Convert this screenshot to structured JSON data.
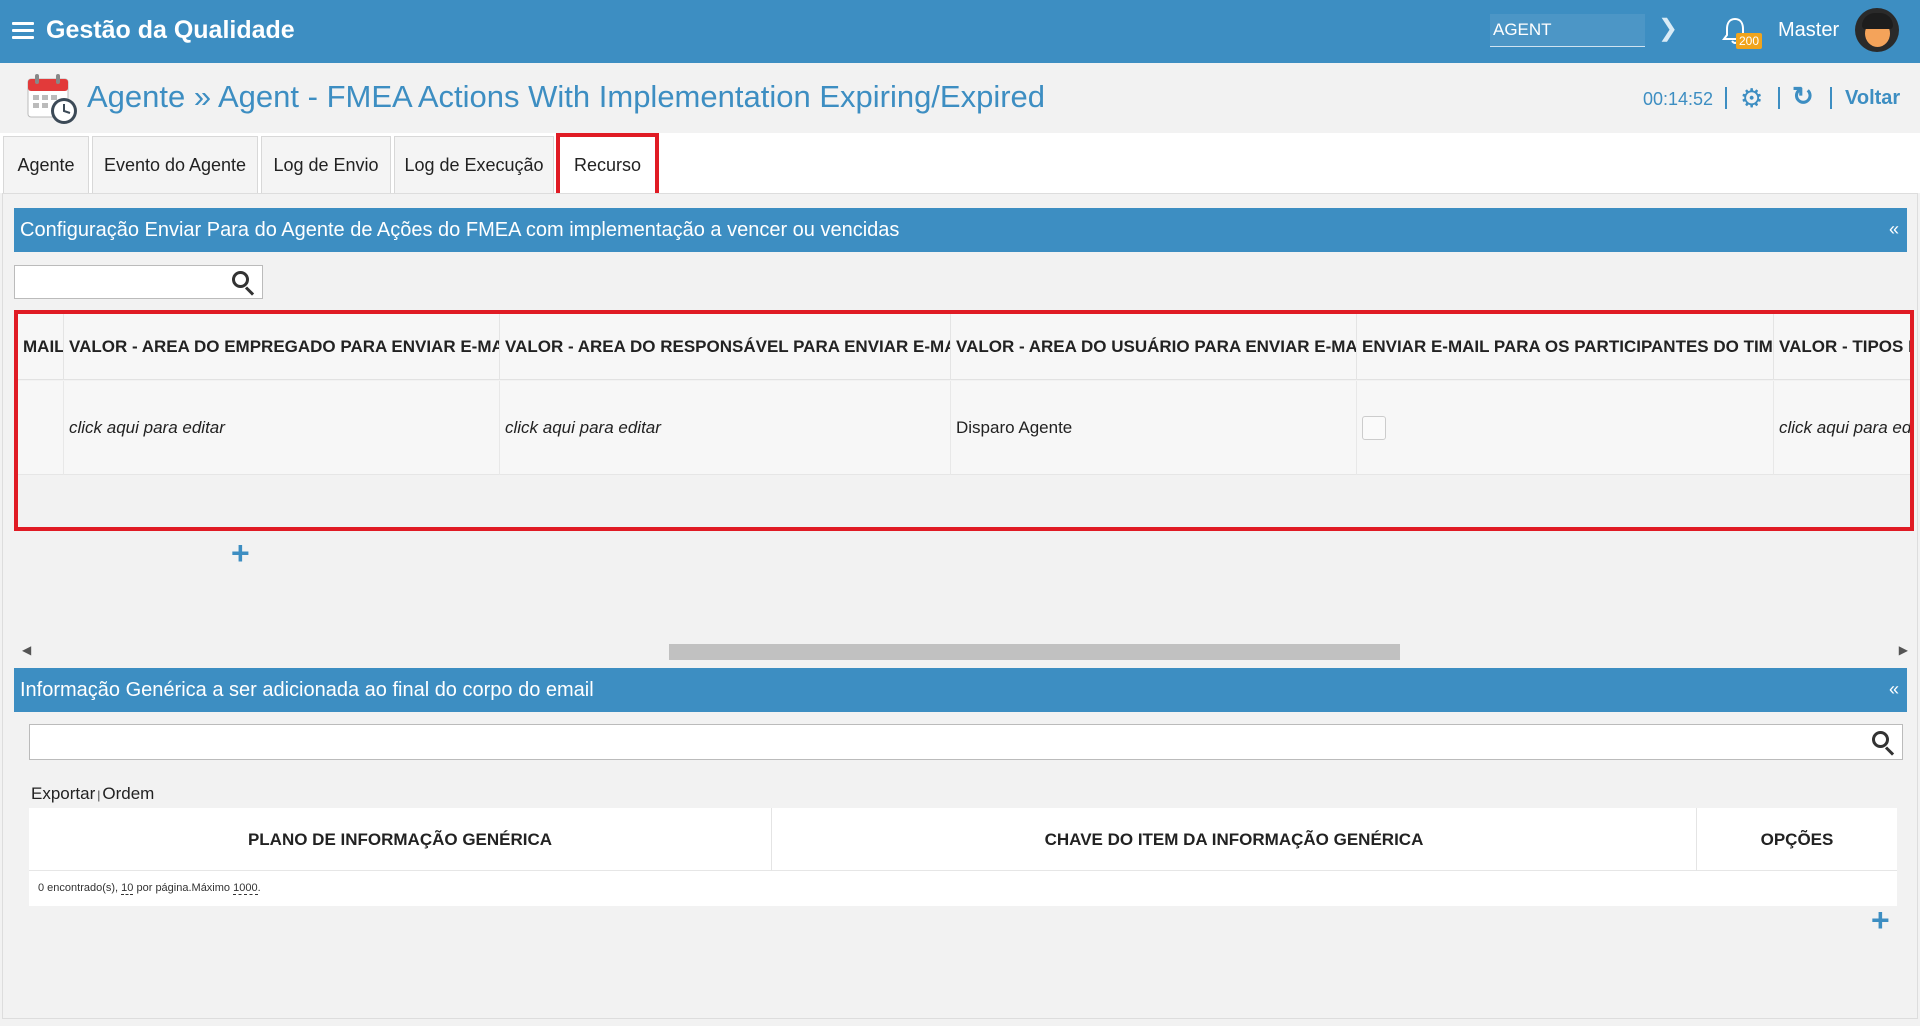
{
  "app": {
    "title": "Gestão da Qualidade"
  },
  "topbar": {
    "agent_select_value": "AGENT",
    "notification_count": "200",
    "user_name": "Master"
  },
  "header": {
    "title": "Agente » Agent - FMEA Actions With Implementation Expiring/Expired",
    "timer": "00:14:52",
    "back_label": "Voltar"
  },
  "tabs": [
    {
      "label": "Agente"
    },
    {
      "label": "Evento do Agente"
    },
    {
      "label": "Log de Envio"
    },
    {
      "label": "Log de Execução"
    },
    {
      "label": "Recurso",
      "active": true
    }
  ],
  "panel1": {
    "title": "Configuração Enviar Para do Agente de Ações do FMEA com implementação a vencer ou vencidas",
    "collapse_label": "«",
    "search_value": "",
    "columns": [
      "MAIL",
      "VALOR - AREA DO EMPREGADO PARA ENVIAR E-MAIL",
      "VALOR - AREA DO RESPONSÁVEL PARA ENVIAR E-MAIL",
      "VALOR - AREA DO USUÁRIO PARA ENVIAR E-MAIL",
      "ENVIAR E-MAIL PARA OS PARTICIPANTES DO TIME",
      "VALOR - TIPOS D"
    ],
    "row": {
      "c0": "",
      "c1": "click aqui para editar",
      "c2": "click aqui para editar",
      "c3": "Disparo Agente",
      "c4_checked": false,
      "c5": "click aqui para edi"
    },
    "add_label": "+"
  },
  "panel2": {
    "title": "Informação Genérica a ser adicionada ao final do corpo do email",
    "collapse_label": "«",
    "search_value": "",
    "export_label": "Exportar",
    "separator": "|",
    "order_label": "Ordem",
    "columns": [
      "PLANO DE INFORMAÇÃO GENÉRICA",
      "CHAVE DO ITEM DA INFORMAÇÃO GENÉRICA",
      "OPÇÕES"
    ],
    "footer": {
      "found_text": "0 encontrado(s),",
      "per_page": "10",
      "per_page_text": "por página.Máximo",
      "max": "1000",
      "end": "."
    },
    "add_label": "+"
  },
  "colors": {
    "primary": "#3d8ec2",
    "highlight": "#e01b24",
    "badge": "#f0a41c"
  }
}
